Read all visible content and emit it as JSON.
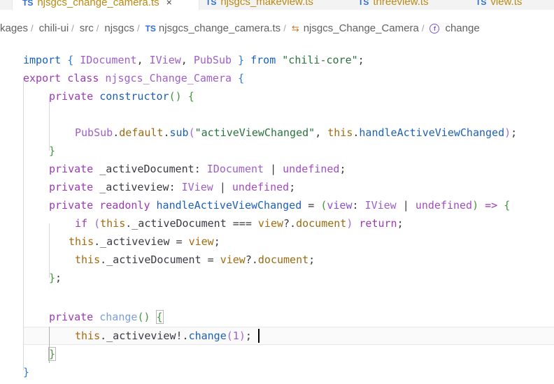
{
  "tabs": [
    {
      "icon": "TS",
      "name": "njsgcs_change_camera.ts",
      "close": "×",
      "active": true
    },
    {
      "icon": "TS",
      "name": "njsgcs_makeview.ts",
      "active": false
    },
    {
      "icon": "TS",
      "name": "threeview.ts",
      "active": false
    },
    {
      "icon": "TS",
      "name": "view.ts",
      "active": false
    }
  ],
  "breadcrumb": {
    "packages": "kages",
    "chili_ui": "chili-ui",
    "src": "src",
    "njsgcs": "njsgcs",
    "file_icon": "TS",
    "file": "njsgcs_change_camera.ts",
    "class_name": "njsgcs_Change_Camera",
    "method": "change",
    "sep": "/"
  },
  "code": {
    "import": "import",
    "lbrace": "{",
    "rbrace": "}",
    "idocument": "IDocument",
    "iview": "IView",
    "pubsub": "PubSub",
    "from": "from",
    "module": "\"chili-core\"",
    "semi": ";",
    "comma": ",",
    "export": "export",
    "class": "class",
    "classname": "njsgcs_Change_Camera",
    "private": "private",
    "constructor": "constructor",
    "parens": "()",
    "default": "default",
    "sub": "sub",
    "event": "\"activeViewChanged\"",
    "this": "this",
    "handler": "handleActiveViewChanged",
    "activeDocument": "_activeDocument",
    "activeview": "_activeview",
    "undefined": "undefined",
    "readonly": "readonly",
    "view": "view",
    "arrow": "=>",
    "if": "if",
    "eq": "===",
    "document": "document",
    "return": "return",
    "change": "change",
    "one": "1",
    "pipe": "|",
    "colon": ":",
    "assign": "=",
    "dot": ".",
    "qdot": "?.",
    "bang": "!"
  }
}
